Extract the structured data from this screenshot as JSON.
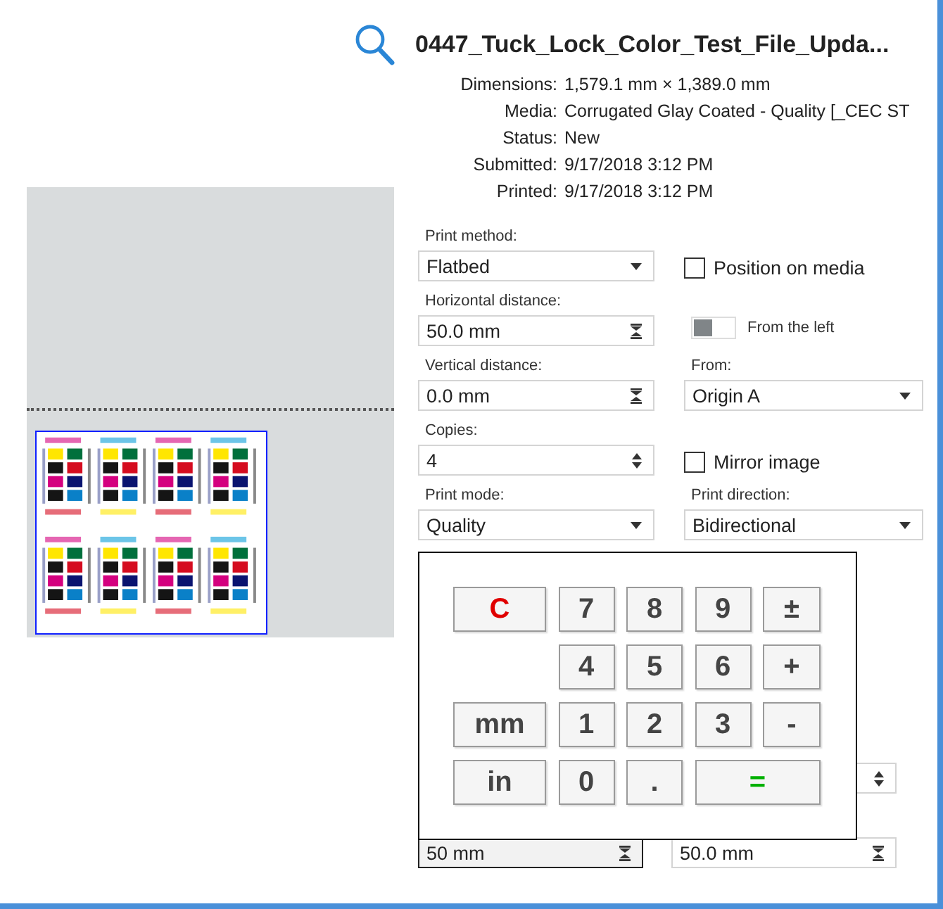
{
  "job": {
    "title": "0447_Tuck_Lock_Color_Test_File_Upda...",
    "details": [
      {
        "label": "Dimensions:",
        "value": "1,579.1 mm × 1,389.0 mm"
      },
      {
        "label": "Media:",
        "value": "Corrugated Glay Coated - Quality [_CEC ST"
      },
      {
        "label": "Status:",
        "value": "New"
      },
      {
        "label": "Submitted:",
        "value": "9/17/2018 3:12 PM"
      },
      {
        "label": "Printed:",
        "value": "9/17/2018 3:12 PM"
      }
    ]
  },
  "form": [
    {
      "kind": "dropdown",
      "label": "Print method:",
      "value": "Flatbed"
    },
    {
      "kind": "checkbox",
      "text": "Position on media",
      "checked": false
    },
    {
      "kind": "distance",
      "label": "Horizontal distance:",
      "value": "50.0 mm"
    },
    {
      "kind": "toggle",
      "text": "From the left",
      "on": false
    },
    {
      "kind": "distance",
      "label": "Vertical distance:",
      "value": "0.0 mm"
    },
    {
      "kind": "dropdown",
      "label": "From:",
      "value": "Origin A"
    },
    {
      "kind": "number",
      "label": "Copies:",
      "value": "4"
    },
    {
      "kind": "checkbox",
      "text": "Mirror image",
      "checked": false
    },
    {
      "kind": "dropdown",
      "label": "Print mode:",
      "value": "Quality"
    },
    {
      "kind": "dropdown",
      "label": "Print direction:",
      "value": "Bidirectional"
    }
  ],
  "lower_fields": [
    {
      "kind": "empty"
    },
    {
      "kind": "number"
    },
    {
      "kind": "distance",
      "value": "50 mm",
      "active": true
    },
    {
      "kind": "distance",
      "value": "50.0 mm",
      "active": false
    }
  ],
  "keypad": {
    "rows": [
      [
        {
          "label": "C",
          "kind": "clear"
        },
        {
          "label": "7",
          "kind": "key"
        },
        {
          "label": "8",
          "kind": "key"
        },
        {
          "label": "9",
          "kind": "key"
        },
        {
          "label": "±",
          "kind": "key"
        }
      ],
      [
        {
          "kind": "blank"
        },
        {
          "label": "4",
          "kind": "key"
        },
        {
          "label": "5",
          "kind": "key"
        },
        {
          "label": "6",
          "kind": "key"
        },
        {
          "label": "+",
          "kind": "key"
        }
      ],
      [
        {
          "label": "mm",
          "kind": "unit"
        },
        {
          "label": "1",
          "kind": "key"
        },
        {
          "label": "2",
          "kind": "key"
        },
        {
          "label": "3",
          "kind": "key"
        },
        {
          "label": "-",
          "kind": "key"
        }
      ],
      [
        {
          "label": "in",
          "kind": "unit"
        },
        {
          "label": "0",
          "kind": "key"
        },
        {
          "label": ".",
          "kind": "key"
        },
        {
          "label": "=",
          "kind": "equals"
        }
      ]
    ]
  }
}
